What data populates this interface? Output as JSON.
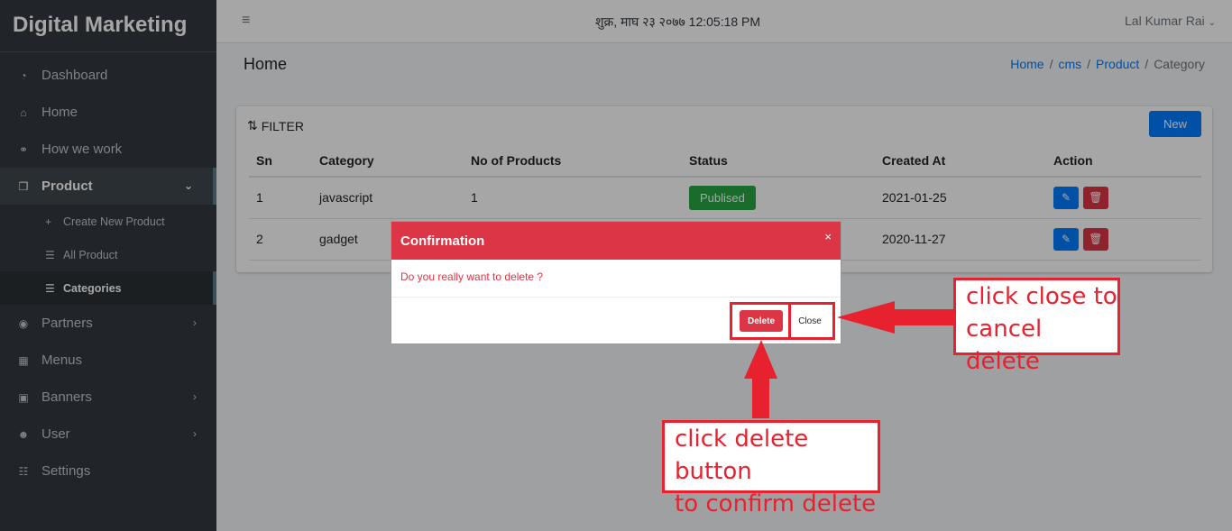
{
  "sidebar": {
    "brand": "Digital Marketing",
    "items": [
      {
        "label": "Dashboard",
        "icon": "dashboard-icon"
      },
      {
        "label": "Home",
        "icon": "home-icon"
      },
      {
        "label": "How we work",
        "icon": "handshake-icon"
      },
      {
        "label": "Product",
        "icon": "copy-icon"
      },
      {
        "label": "Partners",
        "icon": "user-circle-icon"
      },
      {
        "label": "Menus",
        "icon": "grid-icon"
      },
      {
        "label": "Banners",
        "icon": "images-icon"
      },
      {
        "label": "User",
        "icon": "users-icon"
      },
      {
        "label": "Settings",
        "icon": "sliders-icon"
      }
    ],
    "product_sub": [
      {
        "label": "Create New Product"
      },
      {
        "label": "All Product"
      },
      {
        "label": "Categories"
      }
    ]
  },
  "topbar": {
    "datetime": "शुक्र, माघ २३ २०७७ 12:05:18 PM",
    "user": "Lal Kumar Rai"
  },
  "header": {
    "title": "Home",
    "breadcrumb": [
      "Home",
      "cms",
      "Product",
      "Category"
    ]
  },
  "card": {
    "filter_label": "FILTER",
    "new_button": "New",
    "columns": [
      "Sn",
      "Category",
      "No of Products",
      "Status",
      "Created At",
      "Action"
    ],
    "rows": [
      {
        "sn": "1",
        "category": "javascript",
        "count": "1",
        "status": "Publised",
        "created": "2021-01-25"
      },
      {
        "sn": "2",
        "category": "gadget",
        "count": "",
        "status": "",
        "created": "2020-11-27"
      }
    ]
  },
  "modal": {
    "title": "Confirmation",
    "close_x": "×",
    "message": "Do you really want to delete ?",
    "delete_label": "Delete",
    "close_label": "Close"
  },
  "annotations": {
    "close_line1": "click close to",
    "close_line2": "cancel delete",
    "delete_line1": "click delete button",
    "delete_line2": "to confirm delete"
  },
  "colors": {
    "sidebar_bg": "#343a40",
    "primary": "#007bff",
    "danger": "#dc3545",
    "success": "#28a745",
    "annotation_red": "#e8212e"
  }
}
